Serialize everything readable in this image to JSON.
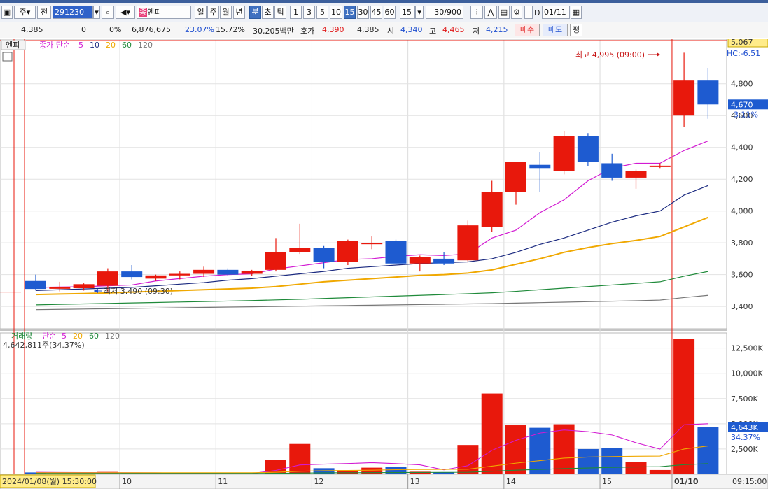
{
  "toolbar": {
    "market": "주",
    "prev_label": "전",
    "code": "291230",
    "badge": "종",
    "name": "엔피",
    "periods": [
      "일",
      "주",
      "월",
      "년",
      "분",
      "초",
      "틱"
    ],
    "selected_period": "분",
    "intervals": [
      "1",
      "3",
      "5",
      "10",
      "15",
      "30",
      "45",
      "60"
    ],
    "selected_interval": "15",
    "interval_value": "15",
    "count": "30",
    "count_max": "/900",
    "date_check_label": "D",
    "date": "01/11"
  },
  "quote": {
    "price": "4,385",
    "change": "0",
    "change_pct": "0%",
    "volume": "6,876,675",
    "volume_ratio": "23.07%",
    "turnover": "15.72%",
    "amount": "30,205백만",
    "ask_label": "호가",
    "ask": "4,390",
    "bid": "4,385",
    "open_label": "시",
    "open": "4,340",
    "high_label": "고",
    "high": "4,465",
    "low_label": "저",
    "low": "4,215",
    "buy_label": "매수",
    "sell_label": "매도",
    "eval_label": "평"
  },
  "price_panel": {
    "tab": "엔피",
    "legend_series": "종가 단순",
    "ma_periods": [
      "5",
      "10",
      "20",
      "60",
      "120"
    ],
    "ma_colors": [
      "#d21ad2",
      "#1b2a80",
      "#f0a800",
      "#1f8a3a",
      "#777777"
    ],
    "top_value": "5,067",
    "hc_label": "HC:-6.51",
    "last_price": "4,670",
    "last_change": "-3.11%",
    "max_label": "최고 4,995 (09:00)",
    "min_label": "최저 3,490 (09:30)"
  },
  "volume_panel": {
    "legend_series": "거래량",
    "legend_ma": "단순",
    "ma_periods": [
      "5",
      "20",
      "60",
      "120"
    ],
    "current": "4,642,811주(34.37%)",
    "last_volume": "4,643K",
    "last_pct": "34.37%"
  },
  "x_axis": {
    "start_label": "2024/01/08(월) 15:30:00",
    "days": [
      "10",
      "11",
      "12",
      "13",
      "14",
      "15",
      "01/10"
    ],
    "end_label": "09:15:00"
  },
  "colors": {
    "up": "#e8180c",
    "down": "#1e5bd0",
    "accent": "#3f70c0"
  },
  "chart_data": [
    {
      "type": "candlestick",
      "ylim": [
        3260,
        5067
      ],
      "y_ticks": [
        3400,
        3600,
        3800,
        4000,
        4200,
        4400,
        4600,
        4800
      ],
      "candles": [
        {
          "o": 3560,
          "h": 3600,
          "l": 3500,
          "c": 3510
        },
        {
          "o": 3515,
          "h": 3555,
          "l": 3495,
          "c": 3520
        },
        {
          "o": 3515,
          "h": 3545,
          "l": 3500,
          "c": 3540
        },
        {
          "o": 3530,
          "h": 3640,
          "l": 3490,
          "c": 3620
        },
        {
          "o": 3620,
          "h": 3660,
          "l": 3570,
          "c": 3585
        },
        {
          "o": 3575,
          "h": 3600,
          "l": 3560,
          "c": 3595
        },
        {
          "o": 3595,
          "h": 3620,
          "l": 3570,
          "c": 3605
        },
        {
          "o": 3605,
          "h": 3650,
          "l": 3585,
          "c": 3630
        },
        {
          "o": 3630,
          "h": 3640,
          "l": 3595,
          "c": 3600
        },
        {
          "o": 3605,
          "h": 3630,
          "l": 3590,
          "c": 3625
        },
        {
          "o": 3630,
          "h": 3830,
          "l": 3620,
          "c": 3740
        },
        {
          "o": 3740,
          "h": 3920,
          "l": 3730,
          "c": 3770
        },
        {
          "o": 3770,
          "h": 3780,
          "l": 3640,
          "c": 3680
        },
        {
          "o": 3680,
          "h": 3820,
          "l": 3660,
          "c": 3810
        },
        {
          "o": 3800,
          "h": 3840,
          "l": 3760,
          "c": 3800
        },
        {
          "o": 3810,
          "h": 3820,
          "l": 3670,
          "c": 3670
        },
        {
          "o": 3670,
          "h": 3720,
          "l": 3620,
          "c": 3710
        },
        {
          "o": 3700,
          "h": 3740,
          "l": 3660,
          "c": 3670
        },
        {
          "o": 3690,
          "h": 3940,
          "l": 3680,
          "c": 3910
        },
        {
          "o": 3900,
          "h": 4190,
          "l": 3870,
          "c": 4120
        },
        {
          "o": 4120,
          "h": 4310,
          "l": 4040,
          "c": 4310
        },
        {
          "o": 4290,
          "h": 4370,
          "l": 4120,
          "c": 4270
        },
        {
          "o": 4250,
          "h": 4500,
          "l": 4230,
          "c": 4470
        },
        {
          "o": 4470,
          "h": 4490,
          "l": 4280,
          "c": 4310
        },
        {
          "o": 4300,
          "h": 4360,
          "l": 4190,
          "c": 4210
        },
        {
          "o": 4210,
          "h": 4260,
          "l": 4140,
          "c": 4250
        },
        {
          "o": 4280,
          "h": 4300,
          "l": 4270,
          "c": 4285
        },
        {
          "o": 4600,
          "h": 4995,
          "l": 4530,
          "c": 4820
        },
        {
          "o": 4820,
          "h": 4900,
          "l": 4580,
          "c": 4670
        }
      ],
      "ma5": [
        3520,
        3522,
        3524,
        3530,
        3535,
        3560,
        3575,
        3590,
        3600,
        3605,
        3635,
        3655,
        3675,
        3695,
        3700,
        3715,
        3725,
        3720,
        3730,
        3830,
        3880,
        3990,
        4070,
        4190,
        4270,
        4300,
        4300,
        4380,
        4440
      ],
      "ma10": [
        3500,
        3505,
        3510,
        3515,
        3520,
        3530,
        3540,
        3550,
        3565,
        3575,
        3590,
        3605,
        3620,
        3640,
        3650,
        3660,
        3670,
        3675,
        3680,
        3700,
        3740,
        3790,
        3830,
        3880,
        3930,
        3970,
        4000,
        4100,
        4160
      ],
      "ma20": [
        3475,
        3478,
        3481,
        3485,
        3490,
        3495,
        3500,
        3505,
        3510,
        3515,
        3525,
        3540,
        3555,
        3565,
        3575,
        3585,
        3595,
        3600,
        3610,
        3630,
        3665,
        3700,
        3740,
        3770,
        3795,
        3815,
        3840,
        3900,
        3960
      ],
      "ma60": [
        3410,
        3413,
        3416,
        3419,
        3422,
        3425,
        3428,
        3431,
        3434,
        3437,
        3441,
        3445,
        3450,
        3455,
        3460,
        3465,
        3470,
        3475,
        3480,
        3486,
        3495,
        3505,
        3515,
        3525,
        3535,
        3545,
        3555,
        3590,
        3620
      ],
      "ma120": [
        3380,
        3382,
        3384,
        3386,
        3388,
        3390,
        3392,
        3394,
        3396,
        3398,
        3400,
        3402,
        3404,
        3406,
        3408,
        3410,
        3412,
        3414,
        3416,
        3418,
        3421,
        3424,
        3427,
        3430,
        3433,
        3436,
        3440,
        3456,
        3470
      ]
    },
    {
      "type": "bar",
      "title": "거래량",
      "ylim": [
        0,
        14000
      ],
      "y_ticks": [
        2500,
        5000,
        7500,
        10000,
        12500
      ],
      "y_tick_labels": [
        "2,500K",
        "5,000K",
        "7,500K",
        "10,000K",
        "12,500K"
      ],
      "values": [
        180,
        0,
        0,
        230,
        150,
        80,
        80,
        80,
        80,
        80,
        1400,
        3000,
        600,
        400,
        650,
        700,
        250,
        200,
        2900,
        8000,
        4850,
        4600,
        4950,
        2500,
        2600,
        1200,
        420,
        13400,
        4643
      ],
      "ma5": [
        200,
        180,
        170,
        160,
        150,
        140,
        120,
        100,
        90,
        85,
        380,
        920,
        1000,
        1060,
        1150,
        1050,
        930,
        440,
        850,
        2370,
        3360,
        4080,
        4390,
        4220,
        3890,
        3120,
        2490,
        4900,
        5000
      ],
      "ma20": [
        150,
        150,
        150,
        150,
        150,
        150,
        150,
        150,
        150,
        150,
        200,
        300,
        350,
        380,
        400,
        450,
        470,
        480,
        500,
        800,
        1100,
        1350,
        1600,
        1700,
        1750,
        1780,
        1800,
        2500,
        2800
      ],
      "ma60": [
        80,
        80,
        80,
        80,
        80,
        80,
        80,
        80,
        80,
        80,
        100,
        120,
        140,
        150,
        160,
        170,
        180,
        190,
        200,
        300,
        400,
        480,
        560,
        620,
        680,
        720,
        750,
        950,
        1050
      ]
    }
  ]
}
